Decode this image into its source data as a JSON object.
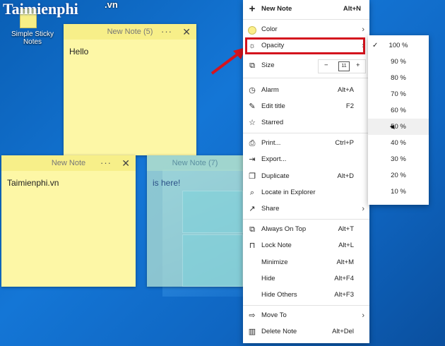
{
  "desktop": {
    "brand_logo": "Taimienphi",
    "brand_sub": ".vn",
    "icon_label": "Simple Sticky Notes"
  },
  "notes": [
    {
      "title": "New Note (5)",
      "body": "Hello"
    },
    {
      "title": "New Note",
      "body": "Taimienphi.vn"
    },
    {
      "title": "New Note (7)",
      "body": "is here!"
    }
  ],
  "menu": {
    "items": [
      {
        "icon": "plus-icon",
        "glyph": "+",
        "label": "New Note",
        "shortcut": "Alt+N"
      },
      {
        "icon": "color-dot-icon",
        "glyph": "",
        "label": "Color",
        "shortcut": "",
        "submenu": true
      },
      {
        "icon": "sun-icon",
        "glyph": "☼",
        "label": "Opacity",
        "shortcut": "",
        "submenu": true
      },
      {
        "icon": "size-icon",
        "glyph": "⧉",
        "label": "Size",
        "shortcut": ""
      },
      {
        "icon": "alarm-icon",
        "glyph": "◷",
        "label": "Alarm",
        "shortcut": "Alt+A"
      },
      {
        "icon": "edit-title-icon",
        "glyph": "✎",
        "label": "Edit title",
        "shortcut": "F2"
      },
      {
        "icon": "star-icon",
        "glyph": "☆",
        "label": "Starred",
        "shortcut": ""
      },
      {
        "icon": "print-icon",
        "glyph": "⎙",
        "label": "Print...",
        "shortcut": "Ctrl+P"
      },
      {
        "icon": "export-icon",
        "glyph": "⇥",
        "label": "Export...",
        "shortcut": ""
      },
      {
        "icon": "duplicate-icon",
        "glyph": "❐",
        "label": "Duplicate",
        "shortcut": "Alt+D"
      },
      {
        "icon": "locate-icon",
        "glyph": "⌕",
        "label": "Locate in Explorer",
        "shortcut": ""
      },
      {
        "icon": "share-icon",
        "glyph": "↗",
        "label": "Share",
        "shortcut": "",
        "submenu": true
      },
      {
        "icon": "always-on-top-icon",
        "glyph": "⧉",
        "label": "Always On Top",
        "shortcut": "Alt+T"
      },
      {
        "icon": "lock-icon",
        "glyph": "🔒",
        "label": "Lock Note",
        "shortcut": "Alt+L"
      },
      {
        "icon": "",
        "glyph": "",
        "label": "Minimize",
        "shortcut": "Alt+M"
      },
      {
        "icon": "",
        "glyph": "",
        "label": "Hide",
        "shortcut": "Alt+F4"
      },
      {
        "icon": "",
        "glyph": "",
        "label": "Hide Others",
        "shortcut": "Alt+F3"
      },
      {
        "icon": "move-to-icon",
        "glyph": "⇨",
        "label": "Move To",
        "shortcut": "",
        "submenu": true
      },
      {
        "icon": "trash-icon",
        "glyph": "🗑",
        "label": "Delete Note",
        "shortcut": "Alt+Del"
      }
    ],
    "size_value": "11"
  },
  "opacity_submenu": {
    "options": [
      "100 %",
      "90 %",
      "80 %",
      "70 %",
      "60 %",
      "50 %",
      "40 %",
      "30 %",
      "20 %",
      "10 %"
    ],
    "checked_index": 0,
    "hover_index": 5
  },
  "colors": {
    "highlight": "#d4141e",
    "note_yellow": "#fdf7a6"
  }
}
